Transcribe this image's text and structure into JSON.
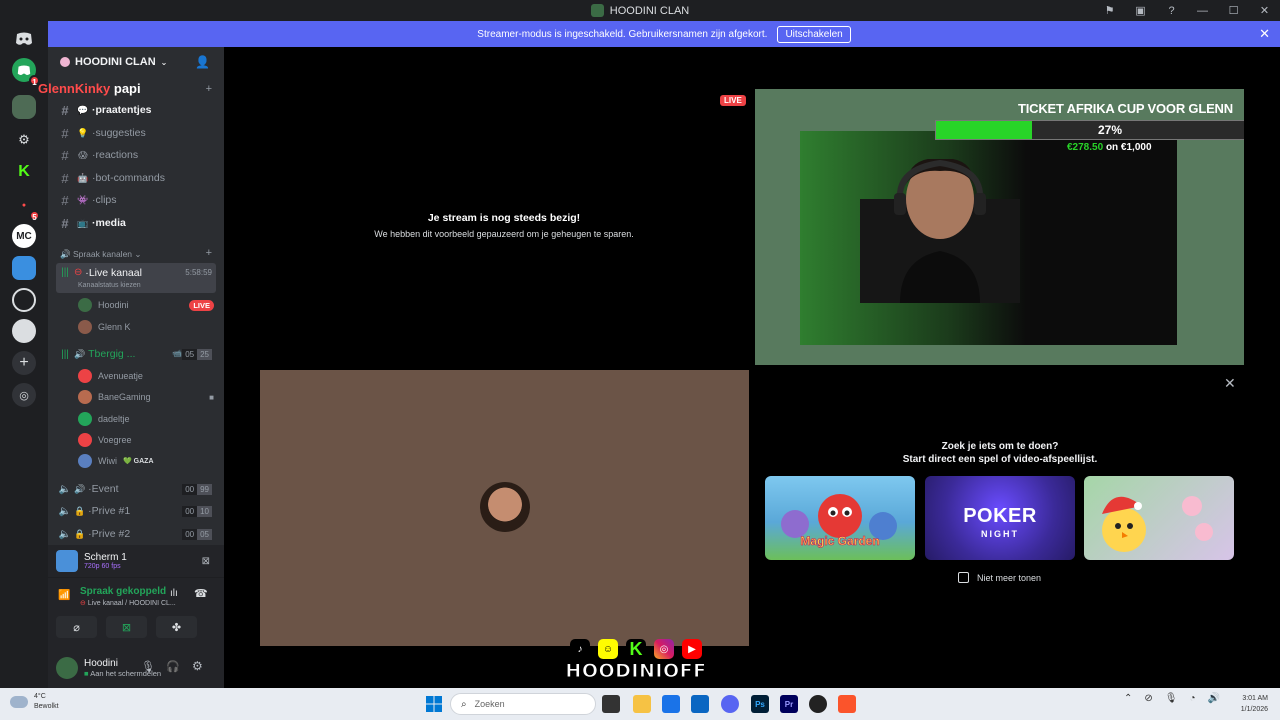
{
  "window": {
    "title": "HOODINI CLAN"
  },
  "banner": {
    "text": "Streamer-modus is ingeschakeld. Gebruikersnamen zijn afgekort.",
    "button": "Uitschakelen"
  },
  "rail": {
    "badges": [
      "1",
      "5"
    ],
    "mc": "MC"
  },
  "guild": {
    "name": "HOODINI CLAN",
    "overlay_name_red": "GlennKinky",
    "overlay_name_white": "papi"
  },
  "channels": [
    {
      "emoji": "💬",
      "name": "praatentjes",
      "bright": true
    },
    {
      "emoji": "💡",
      "name": "suggesties",
      "bright": false
    },
    {
      "emoji": "😱",
      "name": "reactions",
      "bright": false
    },
    {
      "emoji": "🤖",
      "name": "bot-commands",
      "bright": false
    },
    {
      "emoji": "👾",
      "name": "clips",
      "bright": false
    },
    {
      "emoji": "📺",
      "name": "media",
      "bright": true
    }
  ],
  "voice_category": "Spraak kanalen",
  "voice": {
    "live": {
      "name": "Live kanaal",
      "time": "5:58:59",
      "status": "Kanaalstatus kiezen"
    },
    "live_members": [
      {
        "name": "Hoodini",
        "live": "LIVE"
      },
      {
        "name": "Glenn K"
      }
    ],
    "second": {
      "name": "Tbergig ...",
      "counts": [
        "05",
        "25"
      ]
    },
    "second_members": [
      {
        "name": "Avenueatje"
      },
      {
        "name": "BaneGaming"
      },
      {
        "name": "dadeltje"
      },
      {
        "name": "Voegree"
      },
      {
        "name": "Wiwi",
        "tag": "GAZA"
      }
    ],
    "others": [
      {
        "name": "Event",
        "counts": [
          "00",
          "99"
        ]
      },
      {
        "name": "Prive #1",
        "counts": [
          "00",
          "10"
        ]
      },
      {
        "name": "Prive #2",
        "counts": [
          "00",
          "05"
        ]
      }
    ]
  },
  "screen_share": {
    "title": "Scherm 1",
    "quality": "720p 60 fps"
  },
  "voice_panel": {
    "status": "Spraak gekoppeld",
    "channel": "Live kanaal / HOODINI CL..."
  },
  "user": {
    "name": "Hoodini",
    "status": "Aan het schermdelen"
  },
  "stage": {
    "live_label": "LIVE",
    "paused_title": "Je stream is nog steeds bezig!",
    "paused_text": "We hebben dit voorbeeld gepauzeerd om je geheugen te sparen."
  },
  "goal": {
    "title": "TICKET AFRIKA CUP VOOR GLENN",
    "percent_label": "27%",
    "percent": 0.27,
    "raised": "€278.50",
    "of": "on €1,000"
  },
  "activities": {
    "title_line1": "Zoek je iets om te doen?",
    "title_line2": "Start direct een spel of video-afspeellijst.",
    "cards": [
      "Magic Garden",
      "POKER",
      "NIGHT"
    ],
    "dont_show": "Niet meer tonen"
  },
  "overlay": {
    "handle": "HOODINIOFF",
    "k": "K"
  },
  "taskbar": {
    "temp": "4°C",
    "weather": "Bewolkt",
    "search_placeholder": "Zoeken",
    "time": "3:01 AM",
    "date": "1/1/2026"
  }
}
